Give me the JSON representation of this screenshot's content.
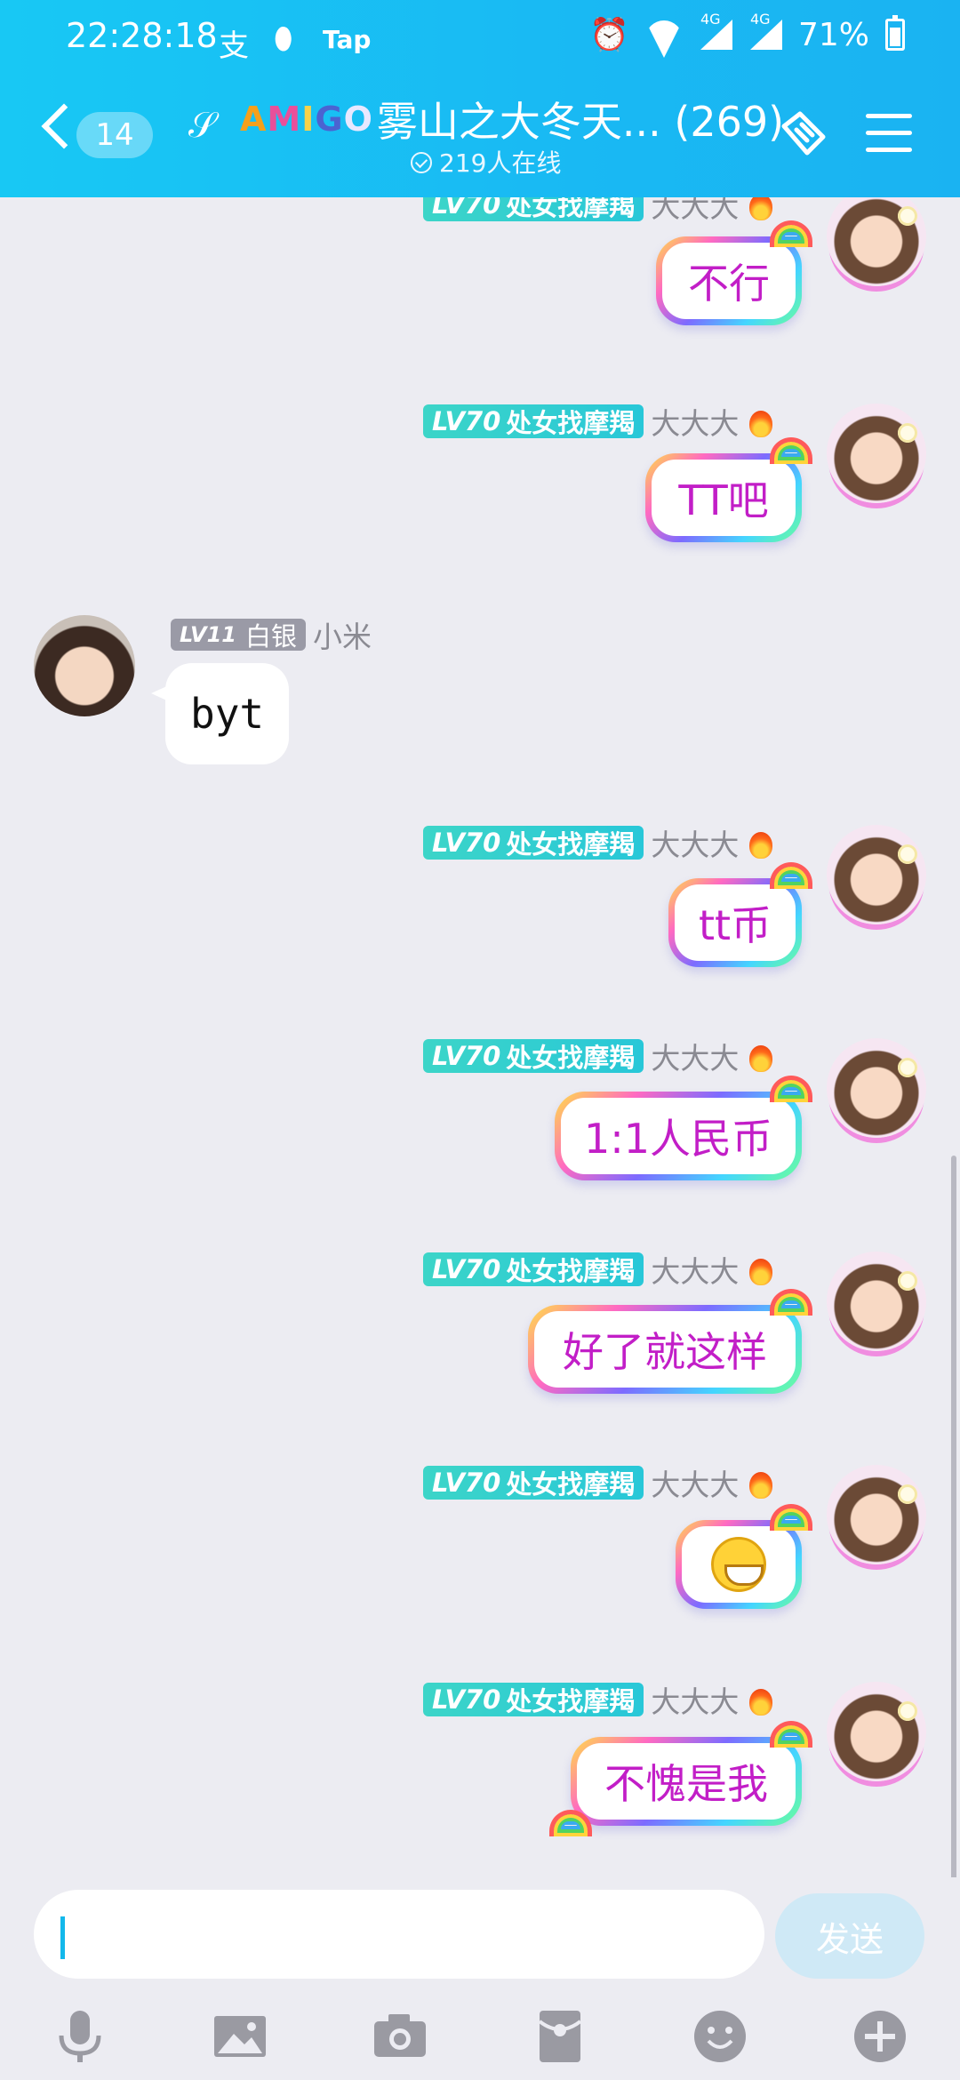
{
  "status_bar": {
    "time": "22:28:18",
    "alipay_icon": "支",
    "tap_label": "Tap",
    "network_4g_1": "4G",
    "network_4g_2": "4G",
    "battery": "71%"
  },
  "header": {
    "unread_count": "14",
    "logo_text": [
      "A",
      "M",
      "I",
      "G",
      "O"
    ],
    "title": "雾山之大冬天... (269)",
    "online": "219人在线"
  },
  "messages": [
    {
      "side": "right",
      "badge_level": "LV70",
      "badge_text": "处女找摩羯",
      "nickname": "大大大",
      "text": "不行"
    },
    {
      "side": "right",
      "badge_level": "LV70",
      "badge_text": "处女找摩羯",
      "nickname": "大大大",
      "text": "TT吧"
    },
    {
      "side": "left",
      "badge_level": "LV11",
      "badge_text": "白银",
      "nickname": "小米",
      "text": "byt"
    },
    {
      "side": "right",
      "badge_level": "LV70",
      "badge_text": "处女找摩羯",
      "nickname": "大大大",
      "text": "tt币"
    },
    {
      "side": "right",
      "badge_level": "LV70",
      "badge_text": "处女找摩羯",
      "nickname": "大大大",
      "text": "1:1人民币"
    },
    {
      "side": "right",
      "badge_level": "LV70",
      "badge_text": "处女找摩羯",
      "nickname": "大大大",
      "text": "好了就这样"
    },
    {
      "side": "right",
      "badge_level": "LV70",
      "badge_text": "处女找摩羯",
      "nickname": "大大大",
      "text": "grin-emoji"
    },
    {
      "side": "right",
      "badge_level": "LV70",
      "badge_text": "处女找摩羯",
      "nickname": "大大大",
      "text": "不愧是我"
    }
  ],
  "input_bar": {
    "placeholder": "",
    "send_label": "发送",
    "tools": [
      "microphone-icon",
      "image-icon",
      "camera-icon",
      "red-packet-icon",
      "emoji-icon",
      "plus-icon"
    ]
  },
  "colors": {
    "header_start": "#18c8f4",
    "header_end": "#1ab3f2",
    "bubble_text": "#c21ec7",
    "badge_lv70": "#2ccad4",
    "send_disabled": "#cfe9f6"
  }
}
